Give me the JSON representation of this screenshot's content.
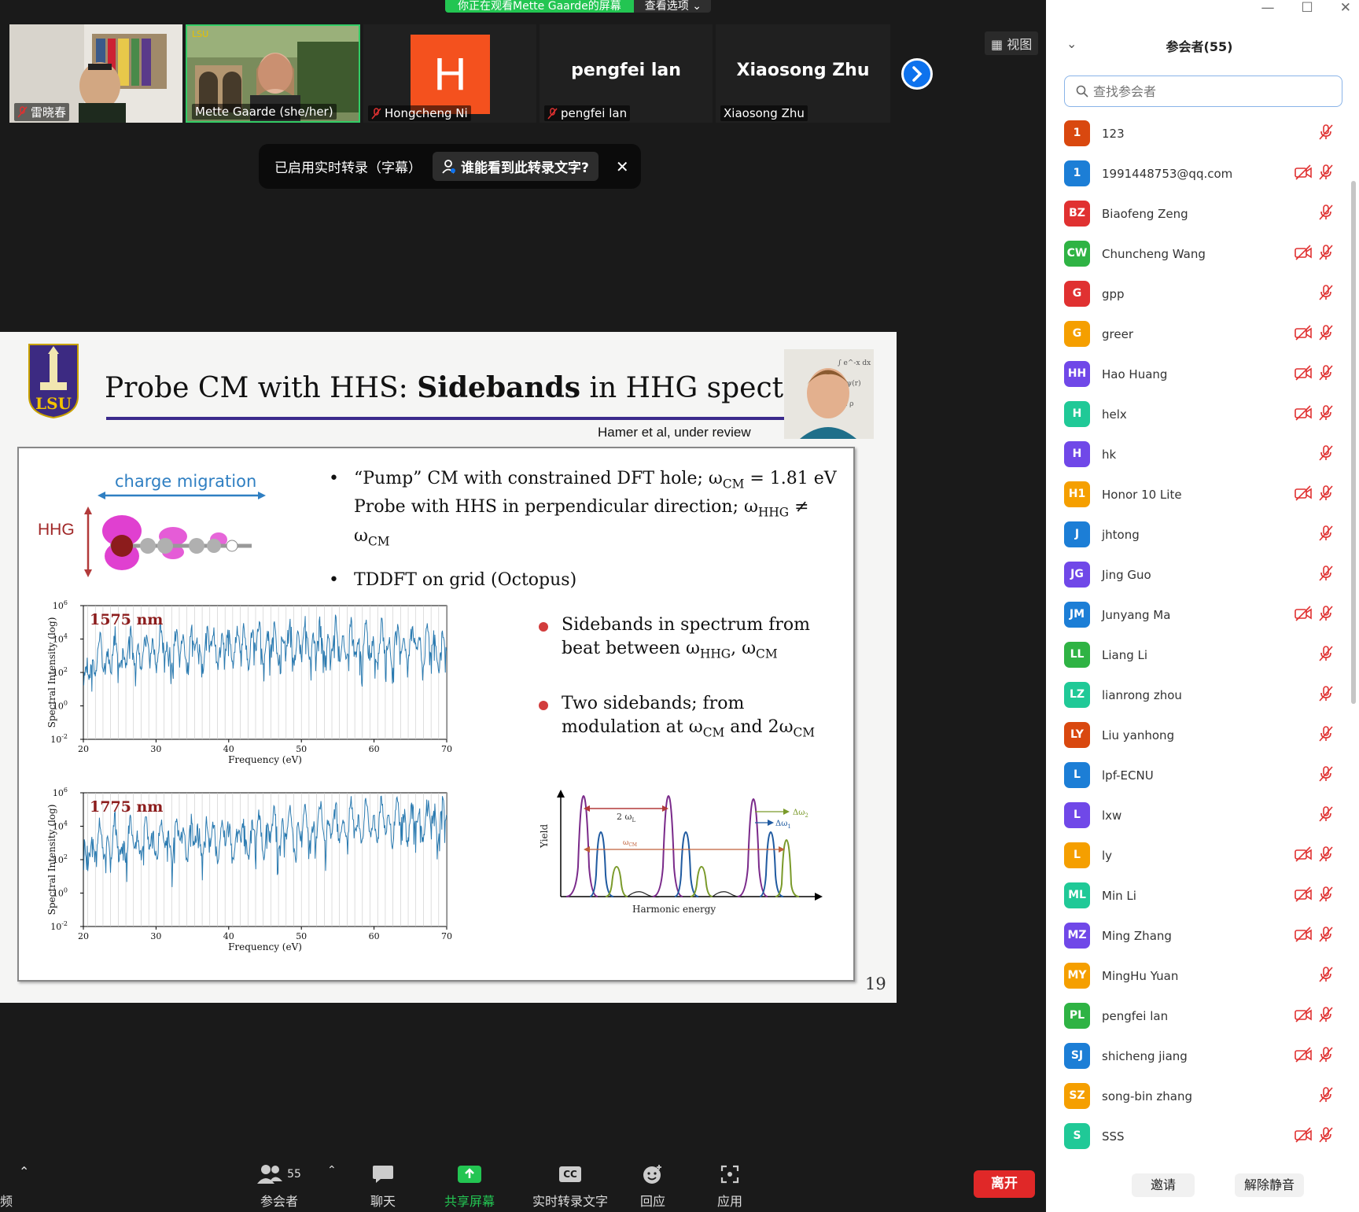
{
  "share_banner": {
    "text": "你正在观看Mette Gaarde的屏幕",
    "options_label": "查看选项",
    "color": "#23c552"
  },
  "video_strip": {
    "tiles": [
      {
        "name": "雷晓春"
      },
      {
        "name": "Mette Gaarde (she/her)"
      },
      {
        "name": "Hongcheng Ni",
        "avatar_letter": "H",
        "avatar_color": "#f4511e"
      },
      {
        "name": "pengfei lan",
        "big_name": "pengfei lan"
      },
      {
        "name": "Xiaosong Zhu",
        "big_name": "Xiaosong Zhu"
      }
    ],
    "view_label": "视图"
  },
  "caption_toast": {
    "text": "已启用实时转录（字幕）",
    "button_label": "谁能看到此转录文字?",
    "close_label": "✕"
  },
  "slide": {
    "title_plain": "Probe CM with HHS: ",
    "title_bold": "Sidebands",
    "title_rest": " in HHG spectrum",
    "citation": "Hamer et al, under review",
    "logo_text": "LSU",
    "page_number": "19",
    "molecule": {
      "cm_label": "charge migration",
      "hhg_label": "HHG"
    },
    "bullets": {
      "b1_line1_pre": "“Pump” CM with constrained DFT hole; ω",
      "b1_line1_sub": "CM",
      "b1_line1_post": " = 1.81 eV",
      "b1_line2_pre": "Probe with HHS in perpendicular direction; ω",
      "b1_line2_sub1": "HHG",
      "b1_line2_mid": " ≠ ω",
      "b1_line2_sub2": "CM",
      "b2": "TDDFT on grid (Octopus)"
    },
    "dot_bullets": {
      "d1_line1": "Sidebands in spectrum from",
      "d1_line2_pre": "beat between ω",
      "d1_line2_sub1": "HHG",
      "d1_line2_mid": ", ω",
      "d1_line2_sub2": "CM",
      "d2_line1": "Two sidebands; from",
      "d2_line2_pre": "modulation at ω",
      "d2_line2_sub1": "CM",
      "d2_line2_mid": " and 2ω",
      "d2_line2_sub2": "CM"
    },
    "plots": [
      {
        "label": "1575 nm",
        "ylabel": "Spectral Intensity (log)",
        "xlabel": "Frequency (eV)"
      },
      {
        "label": "1775 nm",
        "ylabel": "Spectral Intensity (log)",
        "xlabel": "Frequency (eV)"
      }
    ],
    "schematic": {
      "ylabel": "Yield",
      "xlabel": "Harmonic energy",
      "label_2wl": "2 ω",
      "label_2wl_sub": "L",
      "label_wcm": "ω",
      "label_wcm_sub": "CM",
      "label_dw2": "Δω",
      "label_dw2_sub": "2",
      "label_dw1": "Δω",
      "label_dw1_sub": "1"
    },
    "accent_color": "#3b2a8c"
  },
  "chart_data": [
    {
      "type": "line",
      "title": "1575 nm",
      "xlabel": "Frequency (eV)",
      "ylabel": "Spectral Intensity (log)",
      "xlim": [
        20,
        70
      ],
      "ylim": [
        -2,
        6
      ],
      "y_scale": "log10",
      "x_ticks": [
        20,
        30,
        40,
        50,
        60,
        70
      ],
      "y_ticks": [
        "10^-2",
        "10^0",
        "10^2",
        "10^4",
        "10^6"
      ],
      "grid": "vertical lines at harmonic peaks",
      "series": [
        {
          "x": [
            21,
            23,
            25,
            27,
            29,
            31,
            33,
            35,
            37,
            39,
            41,
            43,
            45,
            47,
            49,
            51,
            53,
            55,
            57,
            59,
            61,
            63,
            65,
            67,
            69
          ],
          "y": [
            2.5,
            3.0,
            3.2,
            3.3,
            3.4,
            3.5,
            3.5,
            3.6,
            3.6,
            3.7,
            3.7,
            3.8,
            3.8,
            3.8,
            3.8,
            3.9,
            3.8,
            3.8,
            3.7,
            3.6,
            3.6,
            3.6,
            3.7,
            3.6,
            3.6
          ]
        }
      ]
    },
    {
      "type": "line",
      "title": "1775 nm",
      "xlabel": "Frequency (eV)",
      "ylabel": "Spectral Intensity (log)",
      "xlim": [
        20,
        70
      ],
      "ylim": [
        -2,
        6
      ],
      "y_scale": "log10",
      "x_ticks": [
        20,
        30,
        40,
        50,
        60,
        70
      ],
      "y_ticks": [
        "10^-2",
        "10^0",
        "10^2",
        "10^4",
        "10^6"
      ],
      "grid": "vertical lines at harmonic peaks",
      "series": [
        {
          "x": [
            21,
            23,
            25,
            27,
            29,
            31,
            33,
            35,
            37,
            39,
            41,
            43,
            45,
            47,
            49,
            51,
            53,
            55,
            57,
            59,
            61,
            63,
            65,
            67,
            69
          ],
          "y": [
            2.8,
            3.0,
            3.1,
            3.2,
            3.2,
            3.2,
            3.3,
            3.3,
            3.3,
            3.4,
            3.4,
            3.5,
            3.6,
            3.8,
            3.9,
            4.0,
            4.0,
            4.1,
            4.2,
            4.2,
            4.3,
            4.3,
            4.4,
            4.4,
            4.5
          ]
        }
      ]
    }
  ],
  "toolbar": {
    "left_edge_label": "频",
    "participants_count": "55",
    "participants_label": "参会者",
    "chat_label": "聊天",
    "share_label": "共享屏幕",
    "cc_label": "实时转录文字",
    "cc_icon_text": "CC",
    "react_label": "回应",
    "apps_label": "应用",
    "leave_label": "离开",
    "share_color": "#23c552",
    "leave_color": "#e02828"
  },
  "panel": {
    "title": "参会者(55)",
    "search_placeholder": "查找参会者",
    "invite_label": "邀请",
    "unmute_label": "解除静音",
    "participants": [
      {
        "initials": "1",
        "name": "123",
        "color": "#d9480f",
        "cam_off": false
      },
      {
        "initials": "1",
        "name": "1991448753@qq.com",
        "color": "#1c7ed6",
        "cam_off": true
      },
      {
        "initials": "BZ",
        "name": "Biaofeng Zeng",
        "color": "#e03131",
        "cam_off": false
      },
      {
        "initials": "CW",
        "name": "Chuncheng Wang",
        "color": "#2fb344",
        "cam_off": true
      },
      {
        "initials": "G",
        "name": "gpp",
        "color": "#e03131",
        "cam_off": false
      },
      {
        "initials": "G",
        "name": "greer",
        "color": "#f59f00",
        "cam_off": true
      },
      {
        "initials": "HH",
        "name": "Hao Huang",
        "color": "#7048e8",
        "cam_off": true
      },
      {
        "initials": "H",
        "name": "helx",
        "color": "#20c997",
        "cam_off": true
      },
      {
        "initials": "H",
        "name": "hk",
        "color": "#7048e8",
        "cam_off": false
      },
      {
        "initials": "H1",
        "name": "Honor 10 Lite",
        "color": "#f59f00",
        "cam_off": true
      },
      {
        "initials": "J",
        "name": "jhtong",
        "color": "#1c7ed6",
        "cam_off": false
      },
      {
        "initials": "JG",
        "name": "Jing Guo",
        "color": "#7048e8",
        "cam_off": false
      },
      {
        "initials": "JM",
        "name": "Junyang Ma",
        "color": "#1c7ed6",
        "cam_off": true
      },
      {
        "initials": "LL",
        "name": "Liang Li",
        "color": "#2fb344",
        "cam_off": false
      },
      {
        "initials": "LZ",
        "name": "lianrong zhou",
        "color": "#20c997",
        "cam_off": false
      },
      {
        "initials": "LY",
        "name": "Liu yanhong",
        "color": "#d9480f",
        "cam_off": false
      },
      {
        "initials": "L",
        "name": "lpf-ECNU",
        "color": "#1c7ed6",
        "cam_off": false
      },
      {
        "initials": "L",
        "name": "lxw",
        "color": "#7048e8",
        "cam_off": false
      },
      {
        "initials": "L",
        "name": "ly",
        "color": "#f59f00",
        "cam_off": true
      },
      {
        "initials": "ML",
        "name": "Min Li",
        "color": "#20c997",
        "cam_off": true
      },
      {
        "initials": "MZ",
        "name": "Ming Zhang",
        "color": "#7048e8",
        "cam_off": true
      },
      {
        "initials": "MY",
        "name": "MingHu Yuan",
        "color": "#f59f00",
        "cam_off": false
      },
      {
        "initials": "PL",
        "name": "pengfei lan",
        "color": "#2fb344",
        "cam_off": true
      },
      {
        "initials": "SJ",
        "name": "shicheng jiang",
        "color": "#1c7ed6",
        "cam_off": true
      },
      {
        "initials": "SZ",
        "name": "song-bin zhang",
        "color": "#f59f00",
        "cam_off": false
      },
      {
        "initials": "S",
        "name": "SSS",
        "color": "#20c997",
        "cam_off": true
      }
    ]
  }
}
